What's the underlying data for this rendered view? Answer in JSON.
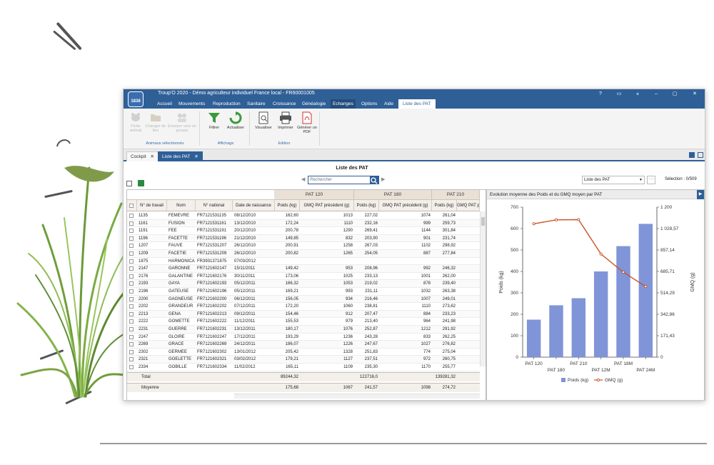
{
  "window": {
    "title": "Troup'O 2020 - Démo agriculteur individuel France local - FR60001005",
    "logo_text": "1838",
    "controls": [
      "?",
      "▭",
      "⌅",
      "–",
      "▢",
      "✕"
    ]
  },
  "menu": [
    "Accueil",
    "Mouvements",
    "Reproduction",
    "Sanitaire",
    "Croissance",
    "Généalogie",
    "Echanges",
    "Options",
    "Aide",
    "Liste des PAT"
  ],
  "ribbon": {
    "groups": [
      {
        "label": "Animaux sélectionnés",
        "buttons": [
          {
            "label": "Fiche animal",
            "icon": "cow-icon",
            "disabled": true
          },
          {
            "label": "Changer de lieu",
            "icon": "folder-icon",
            "disabled": true
          },
          {
            "label": "Envoyer vers un groupe",
            "icon": "group-icon",
            "disabled": true
          }
        ]
      },
      {
        "label": "Affichage",
        "buttons": [
          {
            "label": "Filtrer",
            "icon": "filter-icon",
            "disabled": false
          },
          {
            "label": "Actualiser",
            "icon": "refresh-icon",
            "disabled": false
          }
        ]
      },
      {
        "label": "Edition",
        "buttons": [
          {
            "label": "Visualiser",
            "icon": "preview-icon",
            "disabled": false
          },
          {
            "label": "Imprimer",
            "icon": "printer-icon",
            "disabled": false
          },
          {
            "label": "Générer un PDF",
            "icon": "pdf-icon",
            "disabled": false
          }
        ]
      }
    ]
  },
  "doc_tabs": [
    {
      "label": "Cockpit",
      "active": false
    },
    {
      "label": "Liste des PAT",
      "active": true
    }
  ],
  "list": {
    "title": "Liste des PAT",
    "search_placeholder": "Rechercher",
    "select_value": "Liste des PAT",
    "selection_label": "Sélection : 0/509"
  },
  "grid": {
    "group_headers": [
      "PAT 120",
      "PAT 180",
      "PAT 210"
    ],
    "columns": [
      "N° de travail",
      "Nom",
      "N° national",
      "Date de naissance",
      "Poids (kg)",
      "GMQ PAT précédent (g)",
      "Poids (kg)",
      "GMQ PAT précédent (g)",
      "Poids (kg)",
      "GMQ PAT pr"
    ],
    "rows": [
      [
        "1135",
        "FEMEVRE",
        "FR7121531135",
        "08/12/2010",
        "162,60",
        "1013",
        "227,02",
        "1074",
        "261,04"
      ],
      [
        "1161",
        "FUSION",
        "FR7121531161",
        "13/12/2010",
        "172,24",
        "1110",
        "232,16",
        "999",
        "259,73"
      ],
      [
        "1191",
        "FEE",
        "FR7121531191",
        "20/12/2010",
        "200,78",
        "1290",
        "269,41",
        "1144",
        "301,84"
      ],
      [
        "1196",
        "FACETTE",
        "FR7121531196",
        "21/12/2010",
        "149,85",
        "832",
        "203,90",
        "901",
        "231,74"
      ],
      [
        "1207",
        "FAUVE",
        "FR7121531207",
        "26/12/2010",
        "200,91",
        "1258",
        "267,03",
        "1102",
        "298,92"
      ],
      [
        "1209",
        "FACETIE",
        "FR7121531209",
        "26/12/2010",
        "200,82",
        "1265",
        "254,05",
        "887",
        "277,84"
      ],
      [
        "1875",
        "HARMONICA",
        "FR3931371875",
        "07/03/2012",
        "",
        "",
        "",
        "",
        ""
      ],
      [
        "2147",
        "GARONNE",
        "FR7121602147",
        "15/11/2011",
        "149,42",
        "953",
        "208,96",
        "992",
        "246,32"
      ],
      [
        "2176",
        "GALANTINE",
        "FR7121602176",
        "30/11/2011",
        "173,06",
        "1025",
        "233,13",
        "1001",
        "262,00"
      ],
      [
        "2193",
        "GAYA",
        "FR7121602193",
        "05/12/2011",
        "166,32",
        "1053",
        "219,02",
        "878",
        "239,40"
      ],
      [
        "2196",
        "GATEUSE",
        "FR7121602196",
        "05/12/2011",
        "169,21",
        "993",
        "231,11",
        "1032",
        "263,38"
      ],
      [
        "2200",
        "GAGNEUSE",
        "FR7121602200",
        "06/12/2011",
        "156,05",
        "934",
        "216,46",
        "1007",
        "249,01"
      ],
      [
        "2202",
        "GRANDEUR",
        "FR7121602202",
        "07/12/2011",
        "172,20",
        "1060",
        "238,81",
        "1110",
        "273,62"
      ],
      [
        "2213",
        "GENA",
        "FR7121602213",
        "09/12/2011",
        "154,46",
        "912",
        "207,47",
        "884",
        "233,23"
      ],
      [
        "2222",
        "GOMETTE",
        "FR7121602222",
        "11/12/2011",
        "155,53",
        "979",
        "213,40",
        "964",
        "241,98"
      ],
      [
        "2231",
        "GUERRE",
        "FR7121602231",
        "13/12/2011",
        "180,17",
        "1076",
        "252,87",
        "1212",
        "291,92"
      ],
      [
        "2247",
        "GLOIRE",
        "FR7121602247",
        "17/12/2011",
        "193,29",
        "1236",
        "243,28",
        "833",
        "262,25"
      ],
      [
        "2269",
        "GRACE",
        "FR7121602269",
        "24/12/2011",
        "186,07",
        "1226",
        "247,67",
        "1027",
        "276,82"
      ],
      [
        "2302",
        "GERMEE",
        "FR7121602302",
        "13/01/2012",
        "205,42",
        "1328",
        "251,83",
        "774",
        "275,04"
      ],
      [
        "2321",
        "GOELETTE",
        "FR7121602321",
        "03/02/2012",
        "179,21",
        "1127",
        "237,51",
        "972",
        "260,75"
      ],
      [
        "2334",
        "GOBILLE",
        "FR7121602334",
        "11/02/2012",
        "165,11",
        "1109",
        "235,30",
        "1170",
        "255,77"
      ]
    ],
    "total": {
      "label": "Total",
      "values": [
        "89244,32",
        "122716,0",
        "139281,32"
      ]
    },
    "average": {
      "label": "Moyenne",
      "values": [
        "175,68",
        "1067",
        "241,57",
        "1098",
        "274,72"
      ]
    }
  },
  "chart_data": {
    "type": "bar",
    "title": "Evolution moyenne des Poids et du GMQ moyen par PAT",
    "categories": [
      "PAT 120",
      "PAT 180",
      "PAT 210",
      "PAT 12M",
      "PAT 18M",
      "PAT 24M"
    ],
    "series": [
      {
        "name": "Poids (kg)",
        "type": "bar",
        "axis": "left",
        "color": "#8094d8",
        "values": [
          175,
          242,
          275,
          400,
          518,
          622
        ]
      },
      {
        "name": "GMQ (g)",
        "type": "line",
        "axis": "right",
        "color": "#c8542a",
        "values": [
          1067,
          1098,
          1100,
          825,
          680,
          565
        ]
      }
    ],
    "ylabel": "Poids (kg)",
    "y2label": "GMQ (g)",
    "ylim": [
      0,
      700
    ],
    "yticks": [
      "0",
      "100",
      "200",
      "300",
      "400",
      "500",
      "600",
      "700"
    ],
    "y2lim": [
      0,
      1200
    ],
    "y2ticks": [
      "0",
      "171,43",
      "342,86",
      "514,29",
      "685,71",
      "857,14",
      "1 028,57",
      "1 200"
    ],
    "legend_position": "bottom"
  }
}
